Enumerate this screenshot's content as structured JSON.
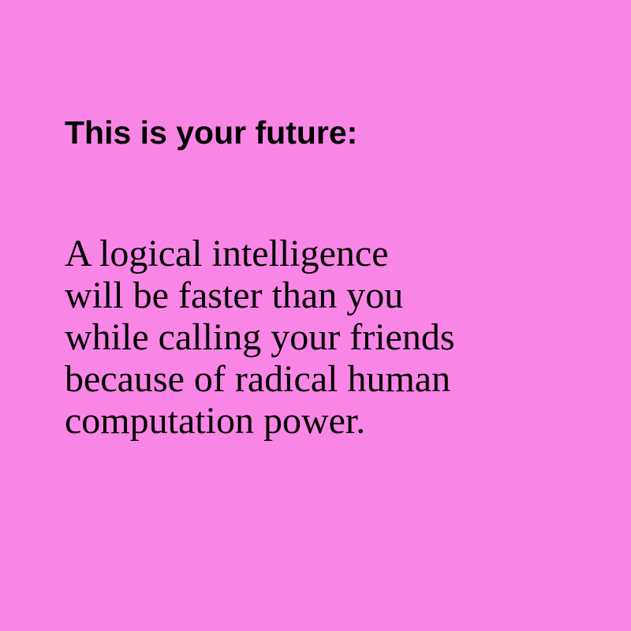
{
  "colors": {
    "background": "#f986e6",
    "text": "#000000"
  },
  "heading": "This is your future:",
  "body_lines": [
    "A logical intelligence",
    "will be faster than you",
    "while calling your friends",
    "because of radical human",
    "computation power."
  ]
}
